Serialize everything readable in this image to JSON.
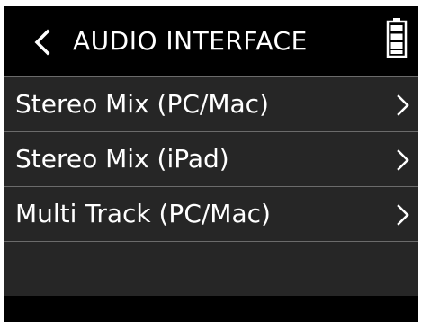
{
  "header": {
    "title": "AUDIO INTERFACE",
    "back_icon": "chevron-left-icon",
    "battery_icon": "battery-full-icon"
  },
  "menu": {
    "items": [
      {
        "label": "Stereo Mix (PC/Mac)",
        "icon": "chevron-right-icon"
      },
      {
        "label": "Stereo Mix (iPad)",
        "icon": "chevron-right-icon"
      },
      {
        "label": "Multi Track (PC/Mac)",
        "icon": "chevron-right-icon"
      }
    ]
  },
  "colors": {
    "background": "#000000",
    "row_background": "#262626",
    "divider": "#6b6b6b",
    "text": "#ffffff"
  }
}
